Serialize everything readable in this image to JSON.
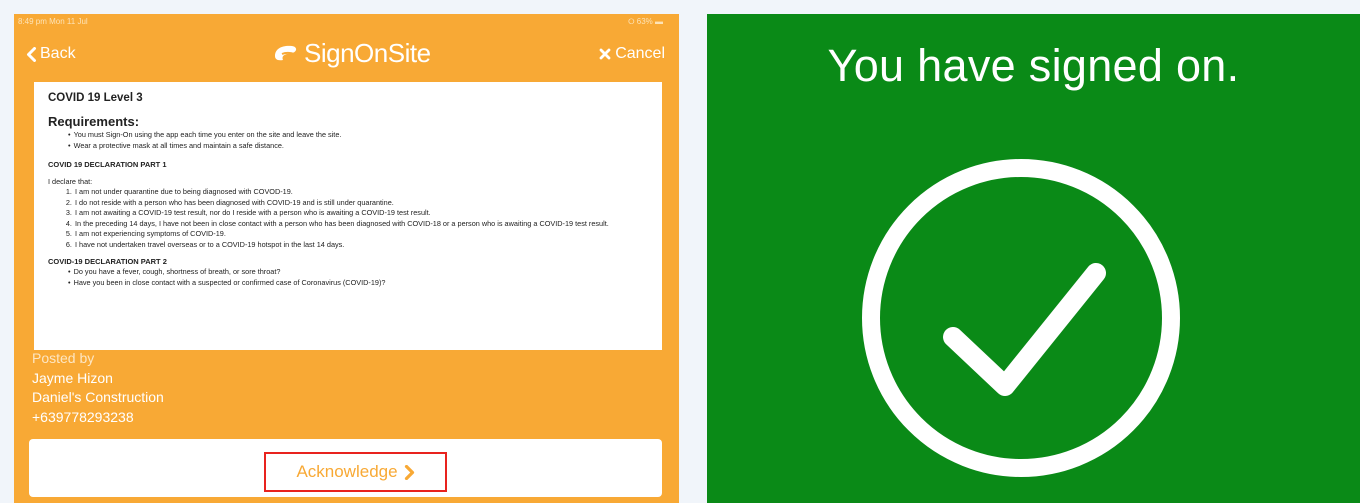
{
  "status_bar": {
    "time": "8:49 pm  Mon 11 Jul",
    "battery": "⭘ 63% ▬"
  },
  "nav": {
    "back_label": "Back",
    "cancel_label": "Cancel",
    "logo_text": "SignOnSite"
  },
  "document": {
    "title": "COVID 19 Level 3",
    "requirements_heading": "Requirements:",
    "requirements": [
      "You must Sign-On using the app each time you enter on the site and leave the site.",
      "Wear a protective mask at all times and maintain a safe distance."
    ],
    "part1_heading": "COVID 19 DECLARATION PART 1",
    "declare_intro": "I declare that:",
    "declarations": [
      "I am not under quarantine due to being diagnosed with COVOD-19.",
      "I do not reside with a person who has been diagnosed with COVID-19 and is still under quarantine.",
      "I am not awaiting a COVID-19 test result,  nor do I reside with a person who is awaiting a COVID-19 test result.",
      "In the preceding 14 days, I have not been in close contact with a person who has been diagnosed with COVID-18 or a person who is awaiting a COVID-19 test result.",
      "I am not experiencing symptoms of COVID-19.",
      "I have not undertaken travel overseas or to a COVID-19 hotspot in the last 14 days."
    ],
    "part2_heading": "COVID-19 DECLARATION PART 2",
    "part2_questions": [
      "Do you have a fever, cough, shortness of breath, or sore throat?",
      "Have you been in close contact with a suspected or confirmed case of Coronavirus (COVID-19)?"
    ]
  },
  "posted": {
    "label": "Posted by",
    "name": "Jayme Hizon",
    "company": "Daniel's Construction",
    "phone": "+639778293238"
  },
  "acknowledge": {
    "label": "Acknowledge"
  },
  "confirmation": {
    "message": "You have signed on."
  },
  "colors": {
    "orange": "#f8a935",
    "green": "#0a8a17",
    "highlight": "#e8231e"
  }
}
